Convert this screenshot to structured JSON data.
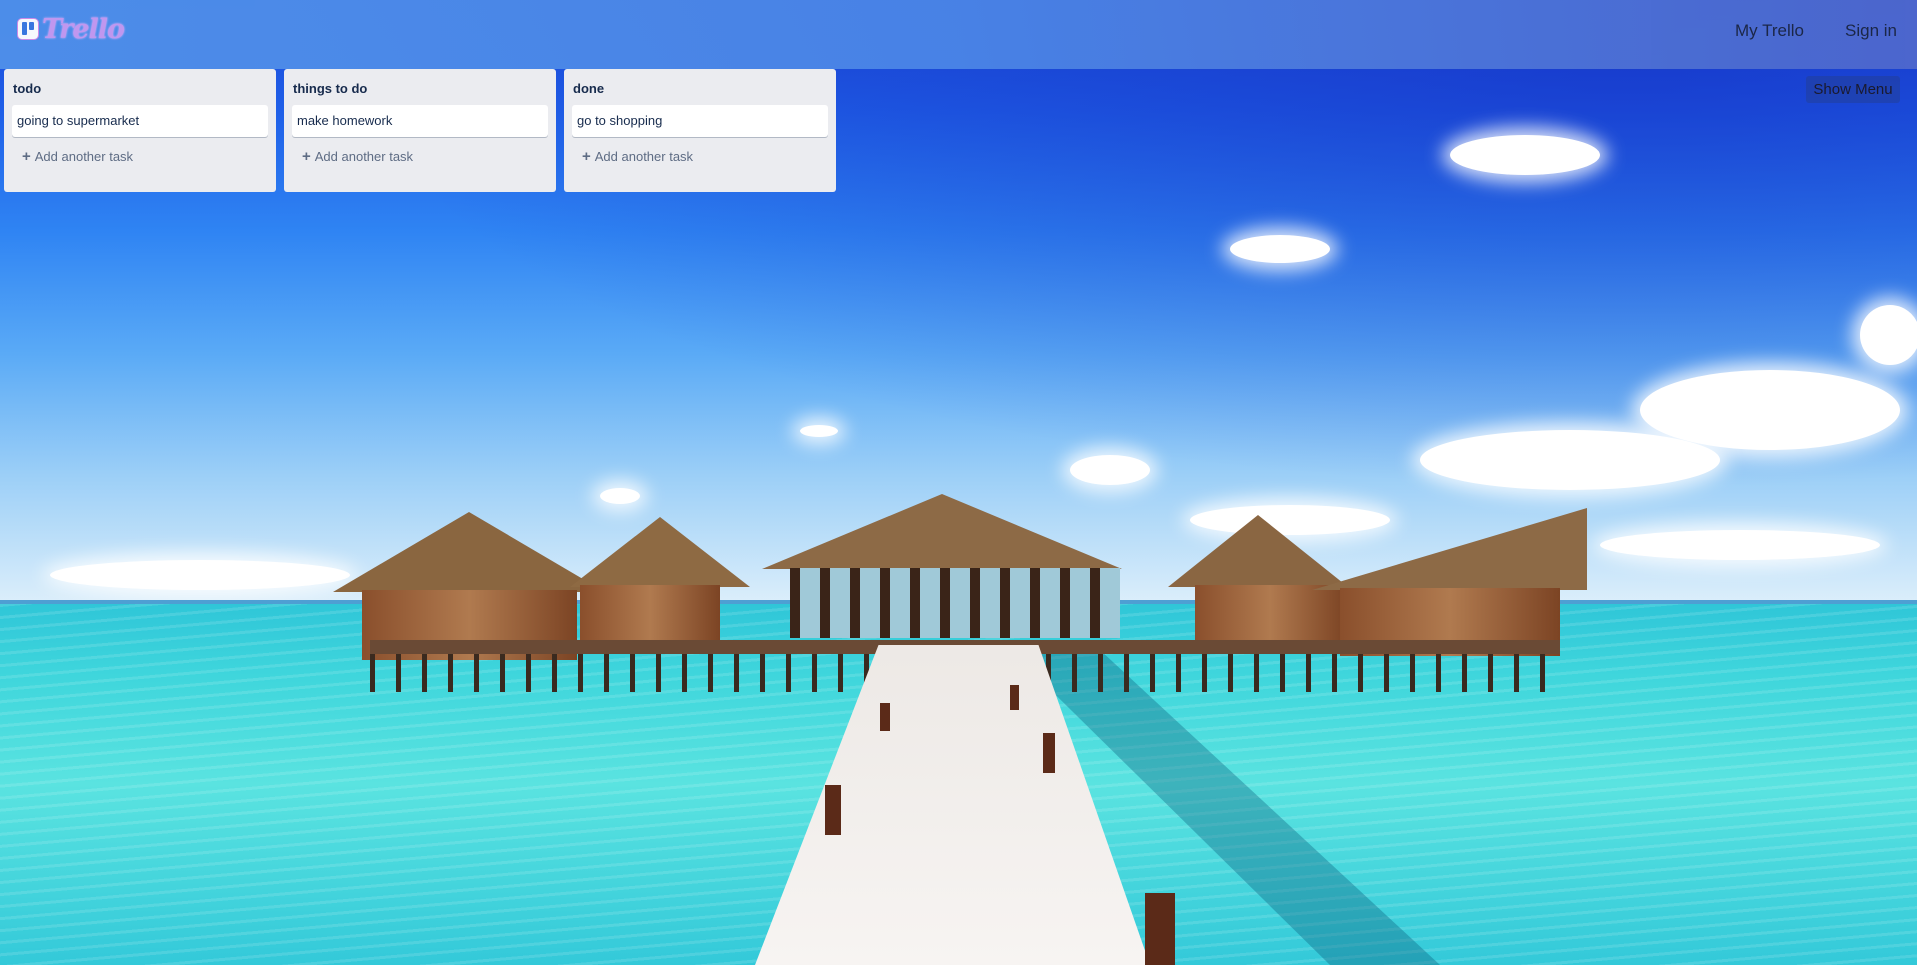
{
  "header": {
    "logo_text": "Trello",
    "nav": {
      "my_trello": "My Trello",
      "sign_in": "Sign in"
    }
  },
  "board": {
    "show_menu_label": "Show Menu",
    "lists": [
      {
        "title": "todo",
        "cards": [
          "going to supermarket"
        ],
        "add_label": "Add another task"
      },
      {
        "title": "things to do",
        "cards": [
          "make homework"
        ],
        "add_label": "Add another task"
      },
      {
        "title": "done",
        "cards": [
          "go to shopping"
        ],
        "add_label": "Add another task"
      }
    ]
  },
  "icons": {
    "add": "plus-icon",
    "logo": "trello-logo-icon"
  },
  "colors": {
    "header_start": "#4f90ea",
    "header_end": "#4e67cd",
    "list_bg": "#ebecf0",
    "card_bg": "#ffffff",
    "text_dark": "#172b4d",
    "text_muted": "#5e6c84"
  }
}
